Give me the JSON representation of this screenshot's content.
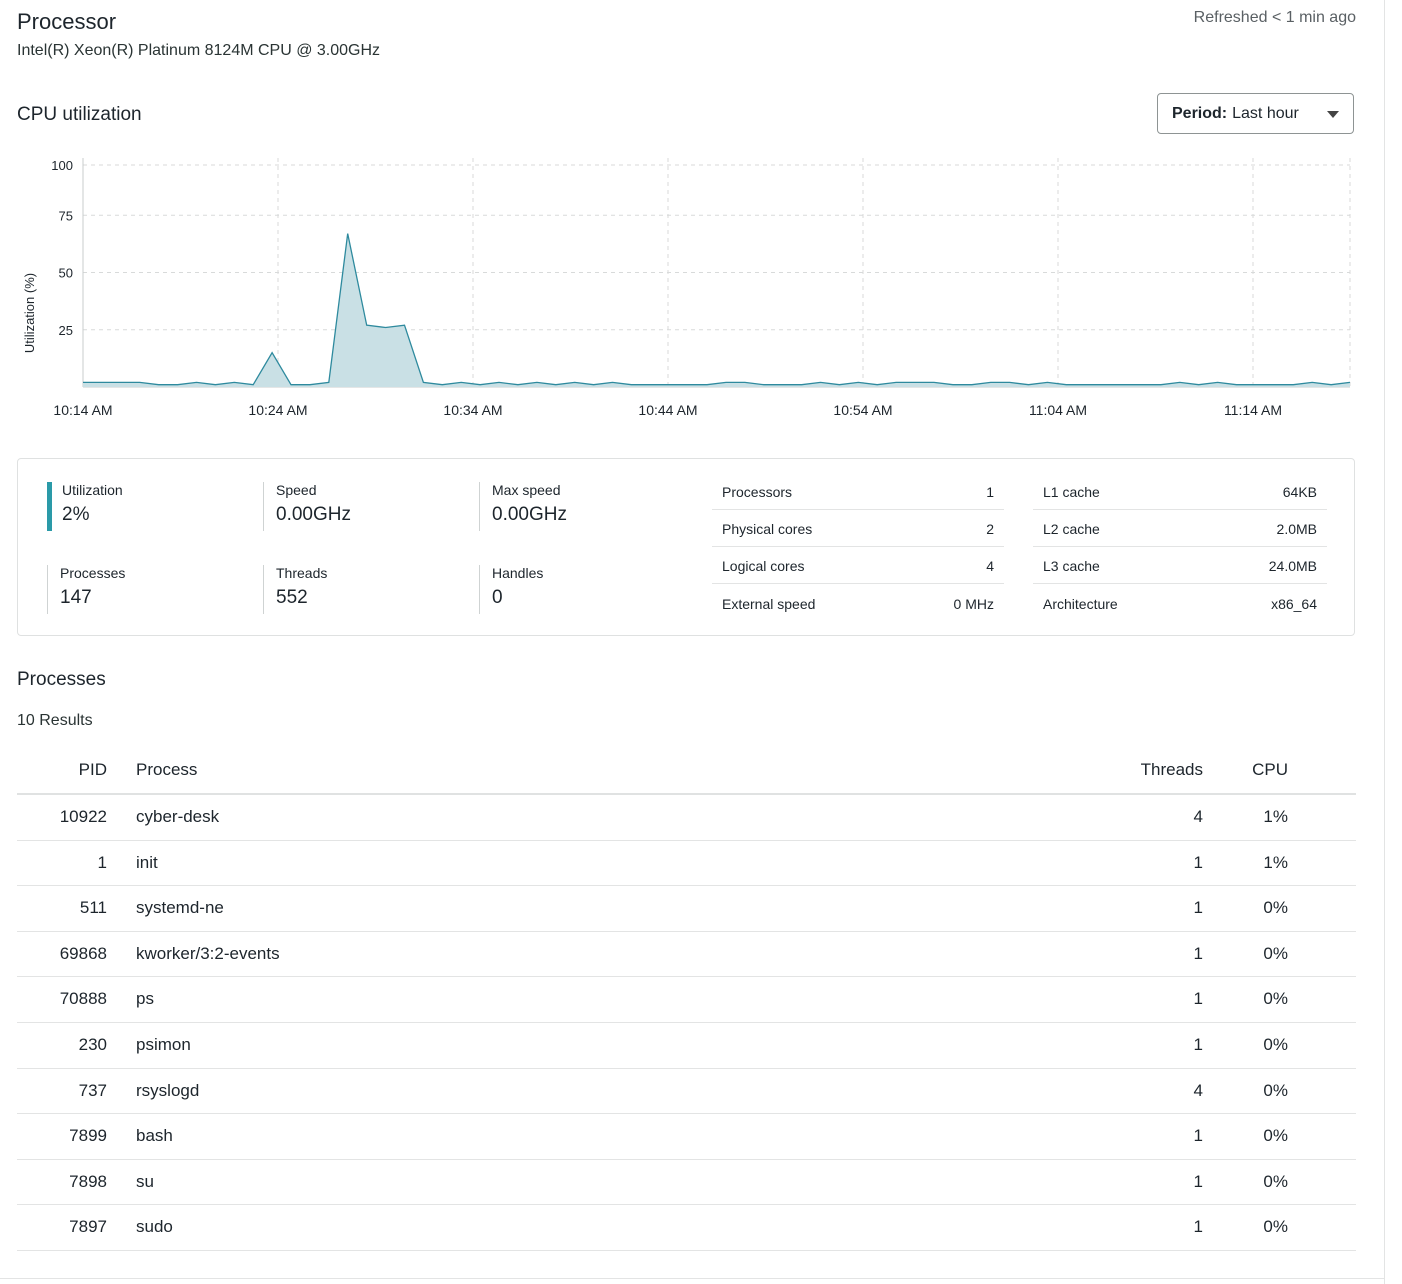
{
  "header": {
    "title": "Processor",
    "subtitle": "Intel(R) Xeon(R) Platinum 8124M CPU @ 3.00GHz",
    "refreshed": "Refreshed < 1 min ago"
  },
  "cpu_section": {
    "title": "CPU utilization",
    "period_label": "Period:",
    "period_value": "Last hour"
  },
  "chart_data": {
    "type": "area",
    "ylabel": "Utilization (%)",
    "xlabel": "",
    "ylim": [
      0,
      100
    ],
    "yticks": [
      25,
      50,
      75,
      100
    ],
    "xticks": [
      "10:14 AM",
      "10:24 AM",
      "10:34 AM",
      "10:44 AM",
      "10:54 AM",
      "11:04 AM",
      "11:14 AM"
    ],
    "x_start_minute": 0,
    "x_tick_interval_minutes": 10,
    "grid": true,
    "color": "#2e8a9e",
    "fill": "#c9e0e5",
    "series": [
      {
        "values": [
          2,
          2,
          2,
          2,
          1,
          1,
          2,
          1,
          2,
          1,
          15,
          1,
          1,
          2,
          67,
          27,
          26,
          27,
          2,
          1,
          2,
          1,
          2,
          1,
          2,
          1,
          2,
          1,
          2,
          1,
          1,
          1,
          1,
          1,
          2,
          2,
          1,
          1,
          1,
          2,
          1,
          2,
          1,
          2,
          2,
          2,
          1,
          1,
          2,
          2,
          1,
          2,
          1,
          1,
          1,
          1,
          1,
          1,
          2,
          1,
          2,
          1,
          1,
          1,
          1,
          2,
          1,
          2
        ]
      }
    ]
  },
  "stats": {
    "utilization": {
      "label": "Utilization",
      "value": "2%"
    },
    "speed": {
      "label": "Speed",
      "value": "0.00GHz"
    },
    "max_speed": {
      "label": "Max speed",
      "value": "0.00GHz"
    },
    "processes": {
      "label": "Processes",
      "value": "147"
    },
    "threads": {
      "label": "Threads",
      "value": "552"
    },
    "handles": {
      "label": "Handles",
      "value": "0"
    },
    "specs_left": [
      {
        "k": "Processors",
        "v": "1"
      },
      {
        "k": "Physical cores",
        "v": "2"
      },
      {
        "k": "Logical cores",
        "v": "4"
      },
      {
        "k": "External speed",
        "v": "0 MHz"
      }
    ],
    "specs_right": [
      {
        "k": "L1 cache",
        "v": "64KB"
      },
      {
        "k": "L2 cache",
        "v": "2.0MB"
      },
      {
        "k": "L3 cache",
        "v": "24.0MB"
      },
      {
        "k": "Architecture",
        "v": "x86_64"
      }
    ]
  },
  "processes": {
    "title": "Processes",
    "results": "10 Results",
    "columns": {
      "pid": "PID",
      "process": "Process",
      "threads": "Threads",
      "cpu": "CPU"
    },
    "rows": [
      {
        "pid": "10922",
        "name": "cyber-desk",
        "threads": "4",
        "cpu": "1%"
      },
      {
        "pid": "1",
        "name": "init",
        "threads": "1",
        "cpu": "1%"
      },
      {
        "pid": "511",
        "name": "systemd-ne",
        "threads": "1",
        "cpu": "0%"
      },
      {
        "pid": "69868",
        "name": "kworker/3:2-events",
        "threads": "1",
        "cpu": "0%"
      },
      {
        "pid": "70888",
        "name": "ps",
        "threads": "1",
        "cpu": "0%"
      },
      {
        "pid": "230",
        "name": "psimon",
        "threads": "1",
        "cpu": "0%"
      },
      {
        "pid": "737",
        "name": "rsyslogd",
        "threads": "4",
        "cpu": "0%"
      },
      {
        "pid": "7899",
        "name": "bash",
        "threads": "1",
        "cpu": "0%"
      },
      {
        "pid": "7898",
        "name": "su",
        "threads": "1",
        "cpu": "0%"
      },
      {
        "pid": "7897",
        "name": "sudo",
        "threads": "1",
        "cpu": "0%"
      }
    ]
  }
}
